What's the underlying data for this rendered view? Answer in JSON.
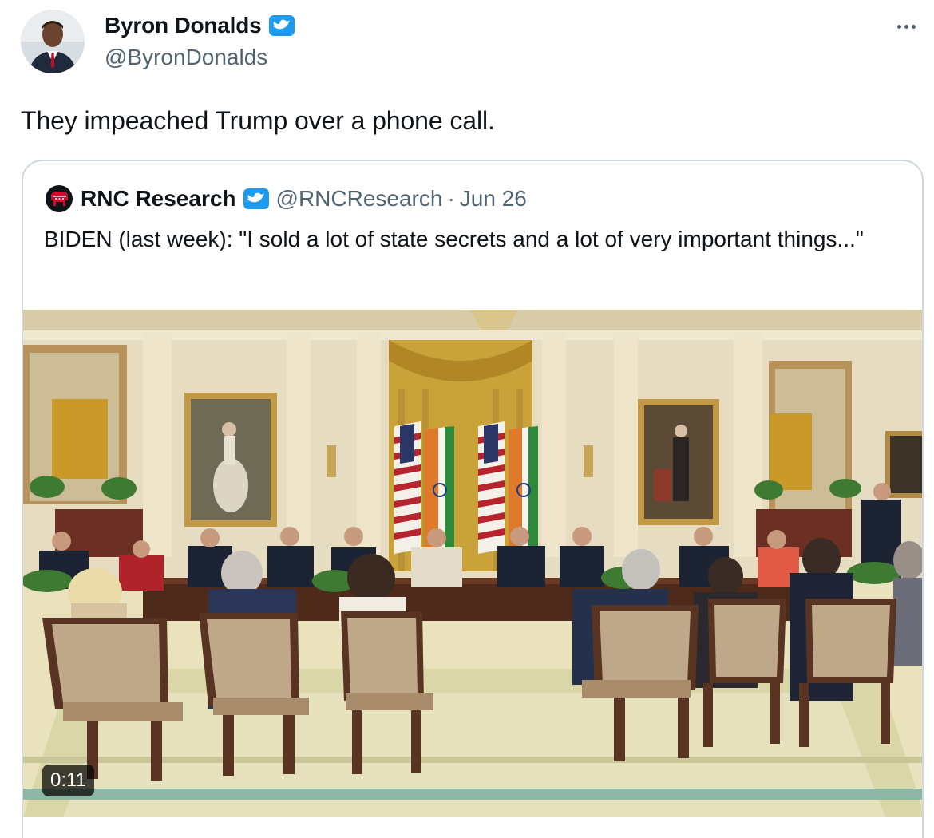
{
  "author": {
    "name": "Byron Donalds",
    "handle": "@ByronDonalds",
    "verified_icon": "verified-badge-icon",
    "avatar_icon": "avatar"
  },
  "menu_icon": "more-options-icon",
  "tweet": {
    "text": "They impeached Trump over a phone call."
  },
  "quote": {
    "name": "RNC Research",
    "handle": "@RNCResearch",
    "separator": "·",
    "date": "Jun 26",
    "text": "BIDEN (last week): \"I sold a lot of state secrets and a lot of very important things...\"",
    "media": {
      "duration": "0:11"
    }
  },
  "colors": {
    "text_primary": "#0f1419",
    "text_secondary": "#536471",
    "verified_blue": "#1d9bf0",
    "border": "#cfd9de",
    "rnc_red": "#c8102e"
  }
}
